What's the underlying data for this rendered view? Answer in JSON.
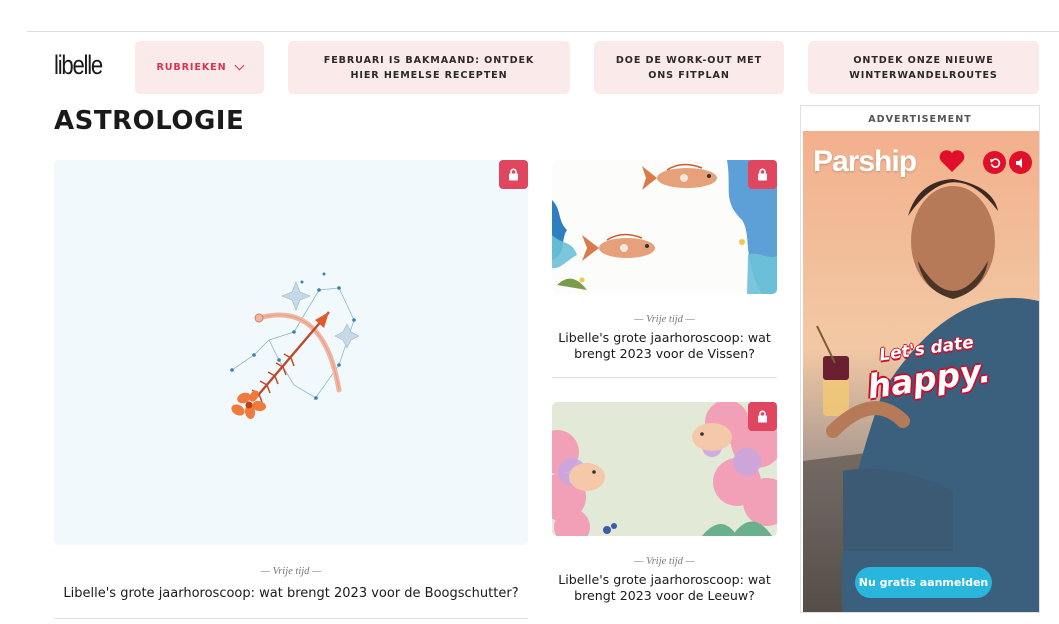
{
  "header": {
    "logo": "libelle",
    "nav": {
      "rubrieken_label": "RUBRIEKEN",
      "items": [
        {
          "label": "FEBRUARI IS BAKMAAND: ONTDEK HIER HEMELSE RECEPTEN"
        },
        {
          "label": "DOE DE WORK-OUT MET ONS FITPLAN"
        },
        {
          "label": "ONTDEK ONZE NIEUWE WINTERWANDELROUTES"
        }
      ]
    }
  },
  "page": {
    "title": "ASTROLOGIE"
  },
  "articles": [
    {
      "category": "— Vrije tijd —",
      "title": "Libelle's grote jaarhoroscoop: wat brengt 2023 voor de Boogschutter?",
      "locked": true,
      "image": "sagittarius-illustration"
    },
    {
      "category": "— Vrije tijd —",
      "title": "Libelle's grote jaarhoroscoop: wat brengt 2023 voor de Vissen?",
      "locked": true,
      "image": "pisces-illustration"
    },
    {
      "category": "— Vrije tijd —",
      "title": "Libelle's grote jaarhoroscoop: wat brengt 2023 voor de Leeuw?",
      "locked": true,
      "image": "leo-illustration"
    }
  ],
  "ad": {
    "label": "ADVERTISEMENT",
    "brand": "Parship",
    "tagline_line1": "Let's date",
    "tagline_line2": "happy.",
    "cta": "Nu gratis aanmelden"
  },
  "icons": [
    "chevron-down-icon",
    "lock-icon",
    "heart-icon",
    "replay-icon",
    "mute-icon"
  ],
  "colors": {
    "accent": "#d6344f",
    "nav_bg": "#fbeaea",
    "lock_badge": "#e0465f",
    "ad_red": "#e0102a",
    "ad_cta": "#29b6dd"
  }
}
